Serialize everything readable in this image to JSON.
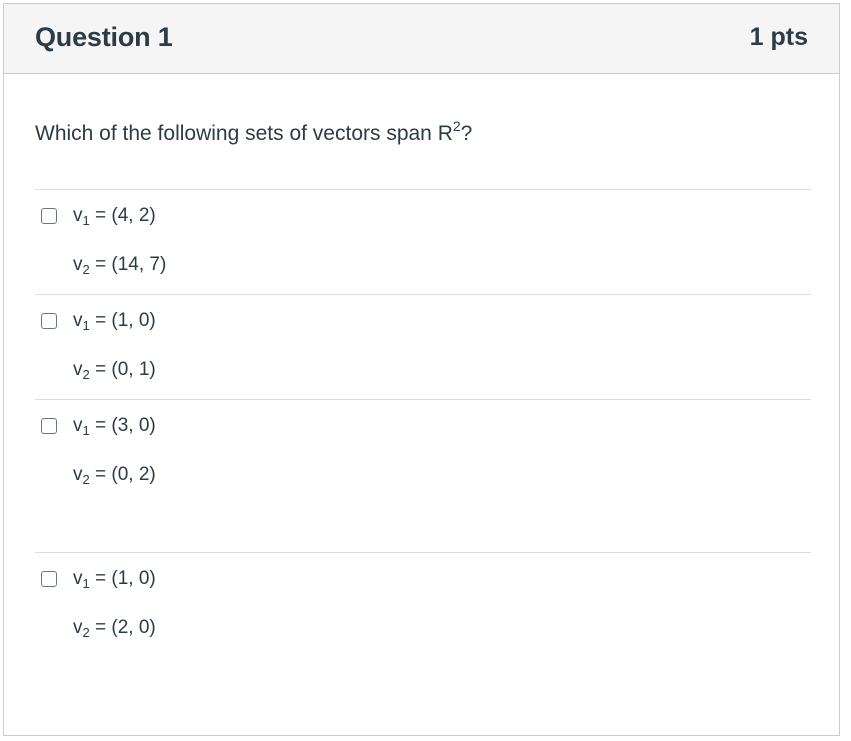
{
  "question": {
    "title": "Question 1",
    "points": "1 pts",
    "prompt_main": "Which of the following sets of vectors span R",
    "prompt_sup": "2",
    "prompt_end": "?"
  },
  "answers": [
    {
      "checked": false,
      "v1": {
        "var": "v",
        "sub": "1",
        "value": " = (4, 2)"
      },
      "v2": {
        "var": "v",
        "sub": "2",
        "value": " = (14, 7)"
      }
    },
    {
      "checked": false,
      "v1": {
        "var": "v",
        "sub": "1",
        "value": " = (1, 0)"
      },
      "v2": {
        "var": "v",
        "sub": "2",
        "value": " = (0, 1)"
      }
    },
    {
      "checked": false,
      "v1": {
        "var": "v",
        "sub": "1",
        "value": " = (3, 0)"
      },
      "v2": {
        "var": "v",
        "sub": "2",
        "value": " = (0, 2)"
      }
    },
    {
      "checked": false,
      "v1": {
        "var": "v",
        "sub": "1",
        "value": " = (1, 0)"
      },
      "v2": {
        "var": "v",
        "sub": "2",
        "value": " = (2, 0)"
      }
    }
  ]
}
